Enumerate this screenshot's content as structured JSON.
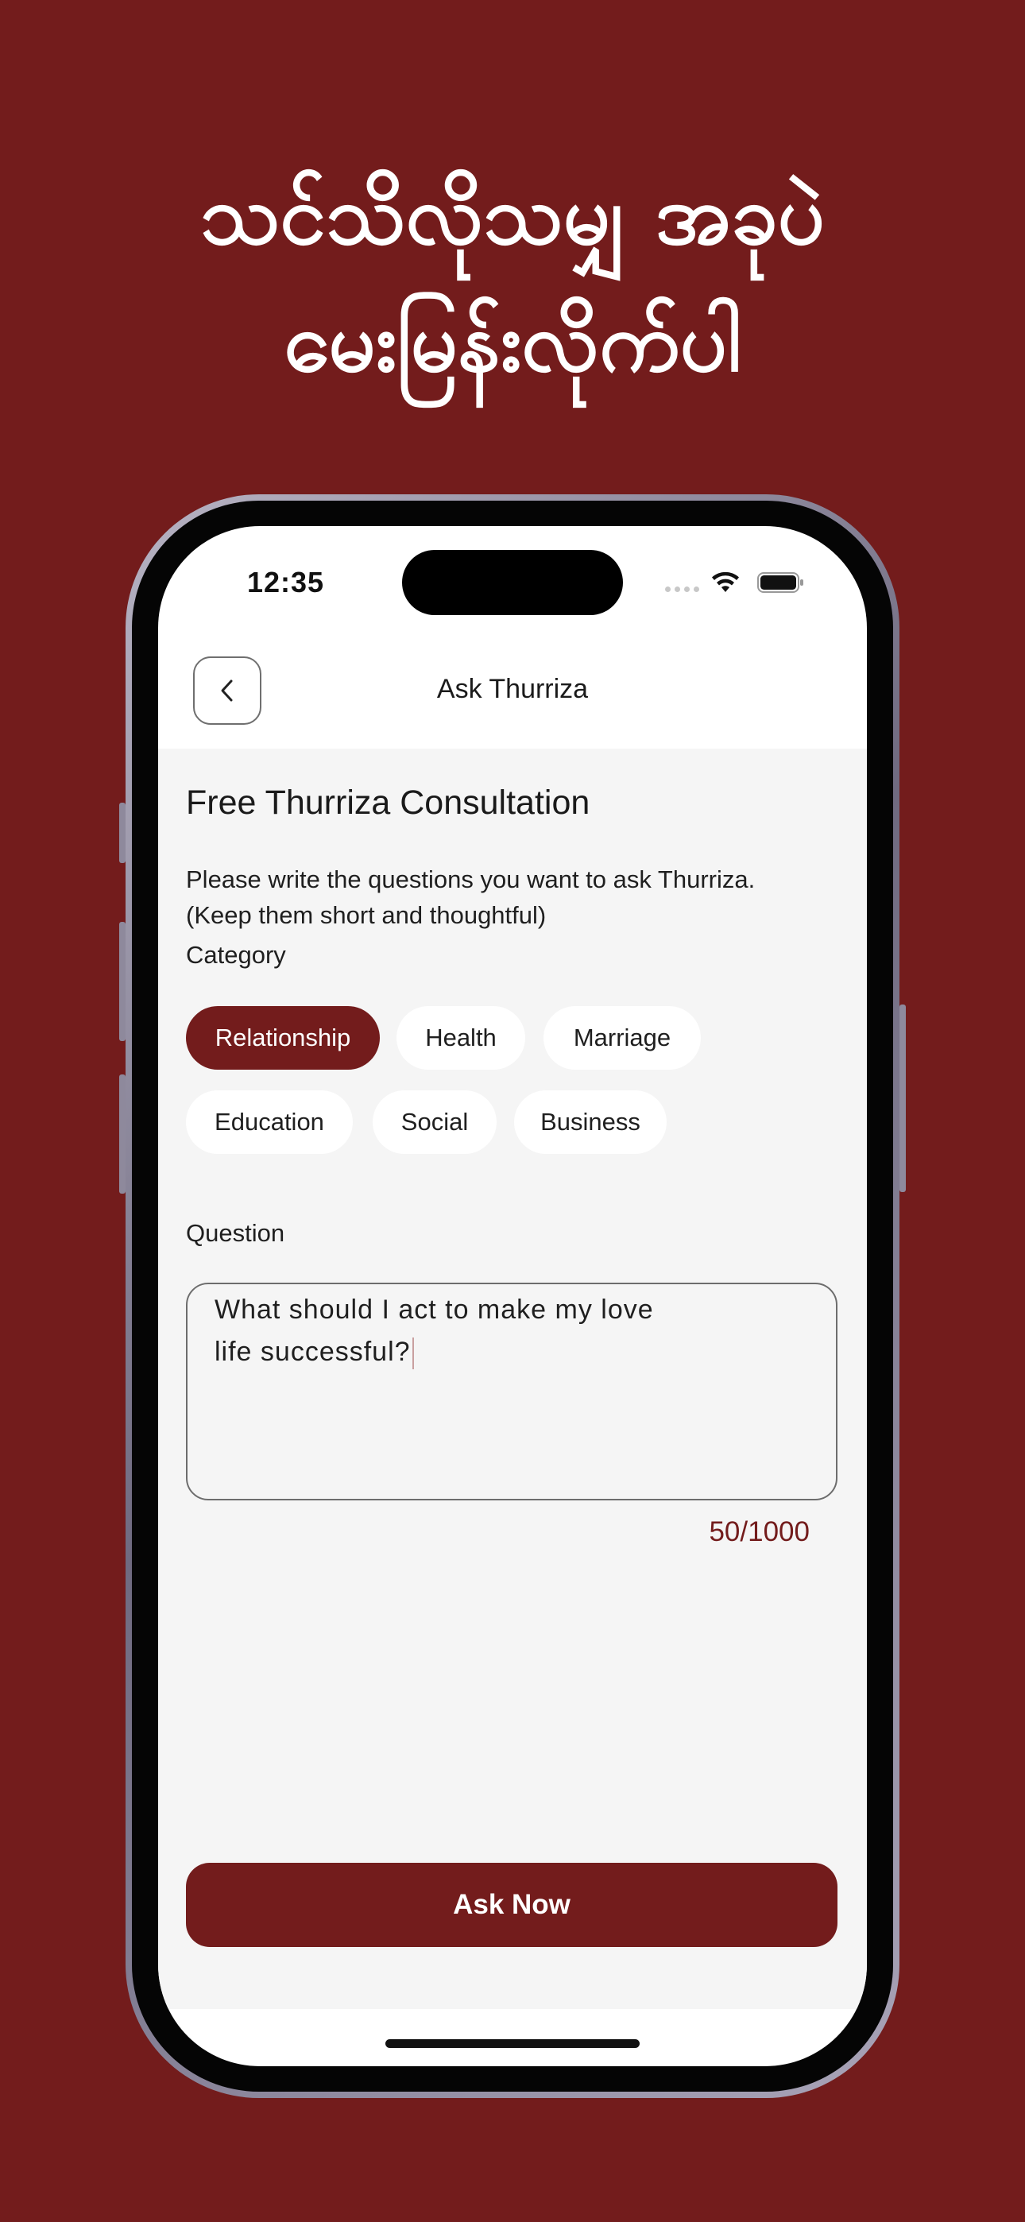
{
  "headline": {
    "line1": "သင်သိလိုသမျှ အခုပဲ",
    "line2": "မေးမြန်းလိုက်ပါ"
  },
  "status_bar": {
    "time": "12:35"
  },
  "nav": {
    "title": "Ask Thurriza",
    "back_icon": "chevron-left-icon"
  },
  "form": {
    "title": "Free Thurriza Consultation",
    "instructions_line1": "Please write the questions you want to ask Thurriza.",
    "instructions_line2": "(Keep them short and thoughtful)",
    "category_label": "Category",
    "categories": [
      {
        "label": "Relationship",
        "selected": true
      },
      {
        "label": "Health",
        "selected": false
      },
      {
        "label": "Marriage",
        "selected": false
      },
      {
        "label": "Education",
        "selected": false
      },
      {
        "label": "Social",
        "selected": false
      },
      {
        "label": "Business",
        "selected": false
      }
    ],
    "question_label": "Question",
    "question_line1": "What should I act to make my love",
    "question_line2": "life successful?",
    "char_count": "50/1000",
    "submit_label": "Ask Now"
  },
  "colors": {
    "brand": "#731c1c",
    "screen_bg": "#f5f5f5",
    "chip_bg": "#ffffff"
  }
}
